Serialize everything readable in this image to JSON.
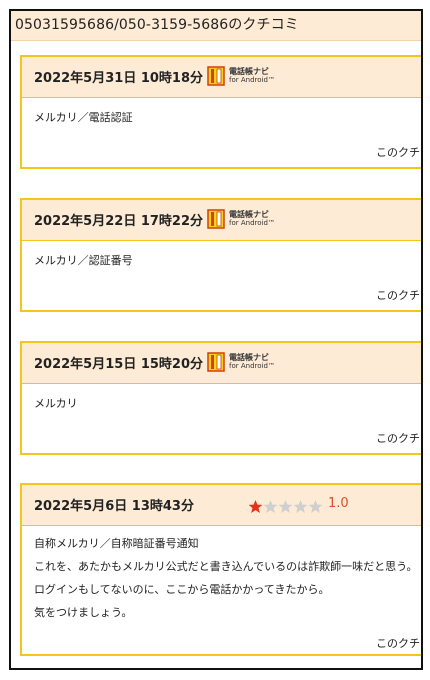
{
  "header": {
    "title": "05031595686/050-3159-5686のクチコミ"
  },
  "app_badge": {
    "name": "電話帳ナビ",
    "sub": "for Android™"
  },
  "reviews": [
    {
      "date": "2022年5月31日 10時18分",
      "lines": [
        "メルカリ／電話認証"
      ],
      "report": "このクチコ",
      "has_app_badge": true
    },
    {
      "date": "2022年5月22日 17時22分",
      "lines": [
        "メルカリ／認証番号"
      ],
      "report": "このクチコ",
      "has_app_badge": true
    },
    {
      "date": "2022年5月15日 15時20分",
      "lines": [
        "メルカリ"
      ],
      "report": "このクチコ",
      "has_app_badge": true
    },
    {
      "date": "2022年5月6日 13時43分",
      "rating": {
        "value": "1.0",
        "filled": 1,
        "total": 5
      },
      "lines": [
        "自称メルカリ／自称暗証番号通知",
        "これを、あたかもメルカリ公式だと書き込んでいるのは詐欺師一味だと思う。",
        "ログインもしてないのに、ここから電話かかってきたから。",
        "気をつけましょう。"
      ],
      "report": "このクチコ",
      "has_app_badge": false
    }
  ],
  "colors": {
    "card_border": "#f2c61d",
    "header_bg": "#fdebd6",
    "star_filled": "#e0341c",
    "star_empty": "#cfcfcf",
    "rating_text": "#d9502a"
  }
}
